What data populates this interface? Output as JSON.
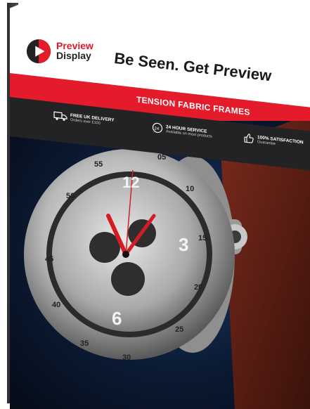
{
  "brand": {
    "line1": "Preview",
    "line2": "Display",
    "colors": {
      "red": "#e41b2a",
      "dark": "#232326"
    }
  },
  "tagline": "Be Seen. Get Preview",
  "banner": "TENSION FABRIC FRAMES",
  "features": [
    {
      "icon": "truck-icon",
      "title": "FREE UK DELIVERY",
      "subtitle": "Orders over £100"
    },
    {
      "icon": "clock-24-icon",
      "title": "24 HOUR SERVICE",
      "subtitle": "Available on most products"
    },
    {
      "icon": "thumbs-up-icon",
      "title": "100% SATISFACTION",
      "subtitle": "Guarantee"
    }
  ],
  "watch": {
    "bezel_numbers": [
      "05",
      "10",
      "15",
      "20",
      "25",
      "30",
      "35",
      "40",
      "45",
      "50",
      "55"
    ],
    "dial_numbers": [
      "12",
      "3",
      "6"
    ]
  }
}
